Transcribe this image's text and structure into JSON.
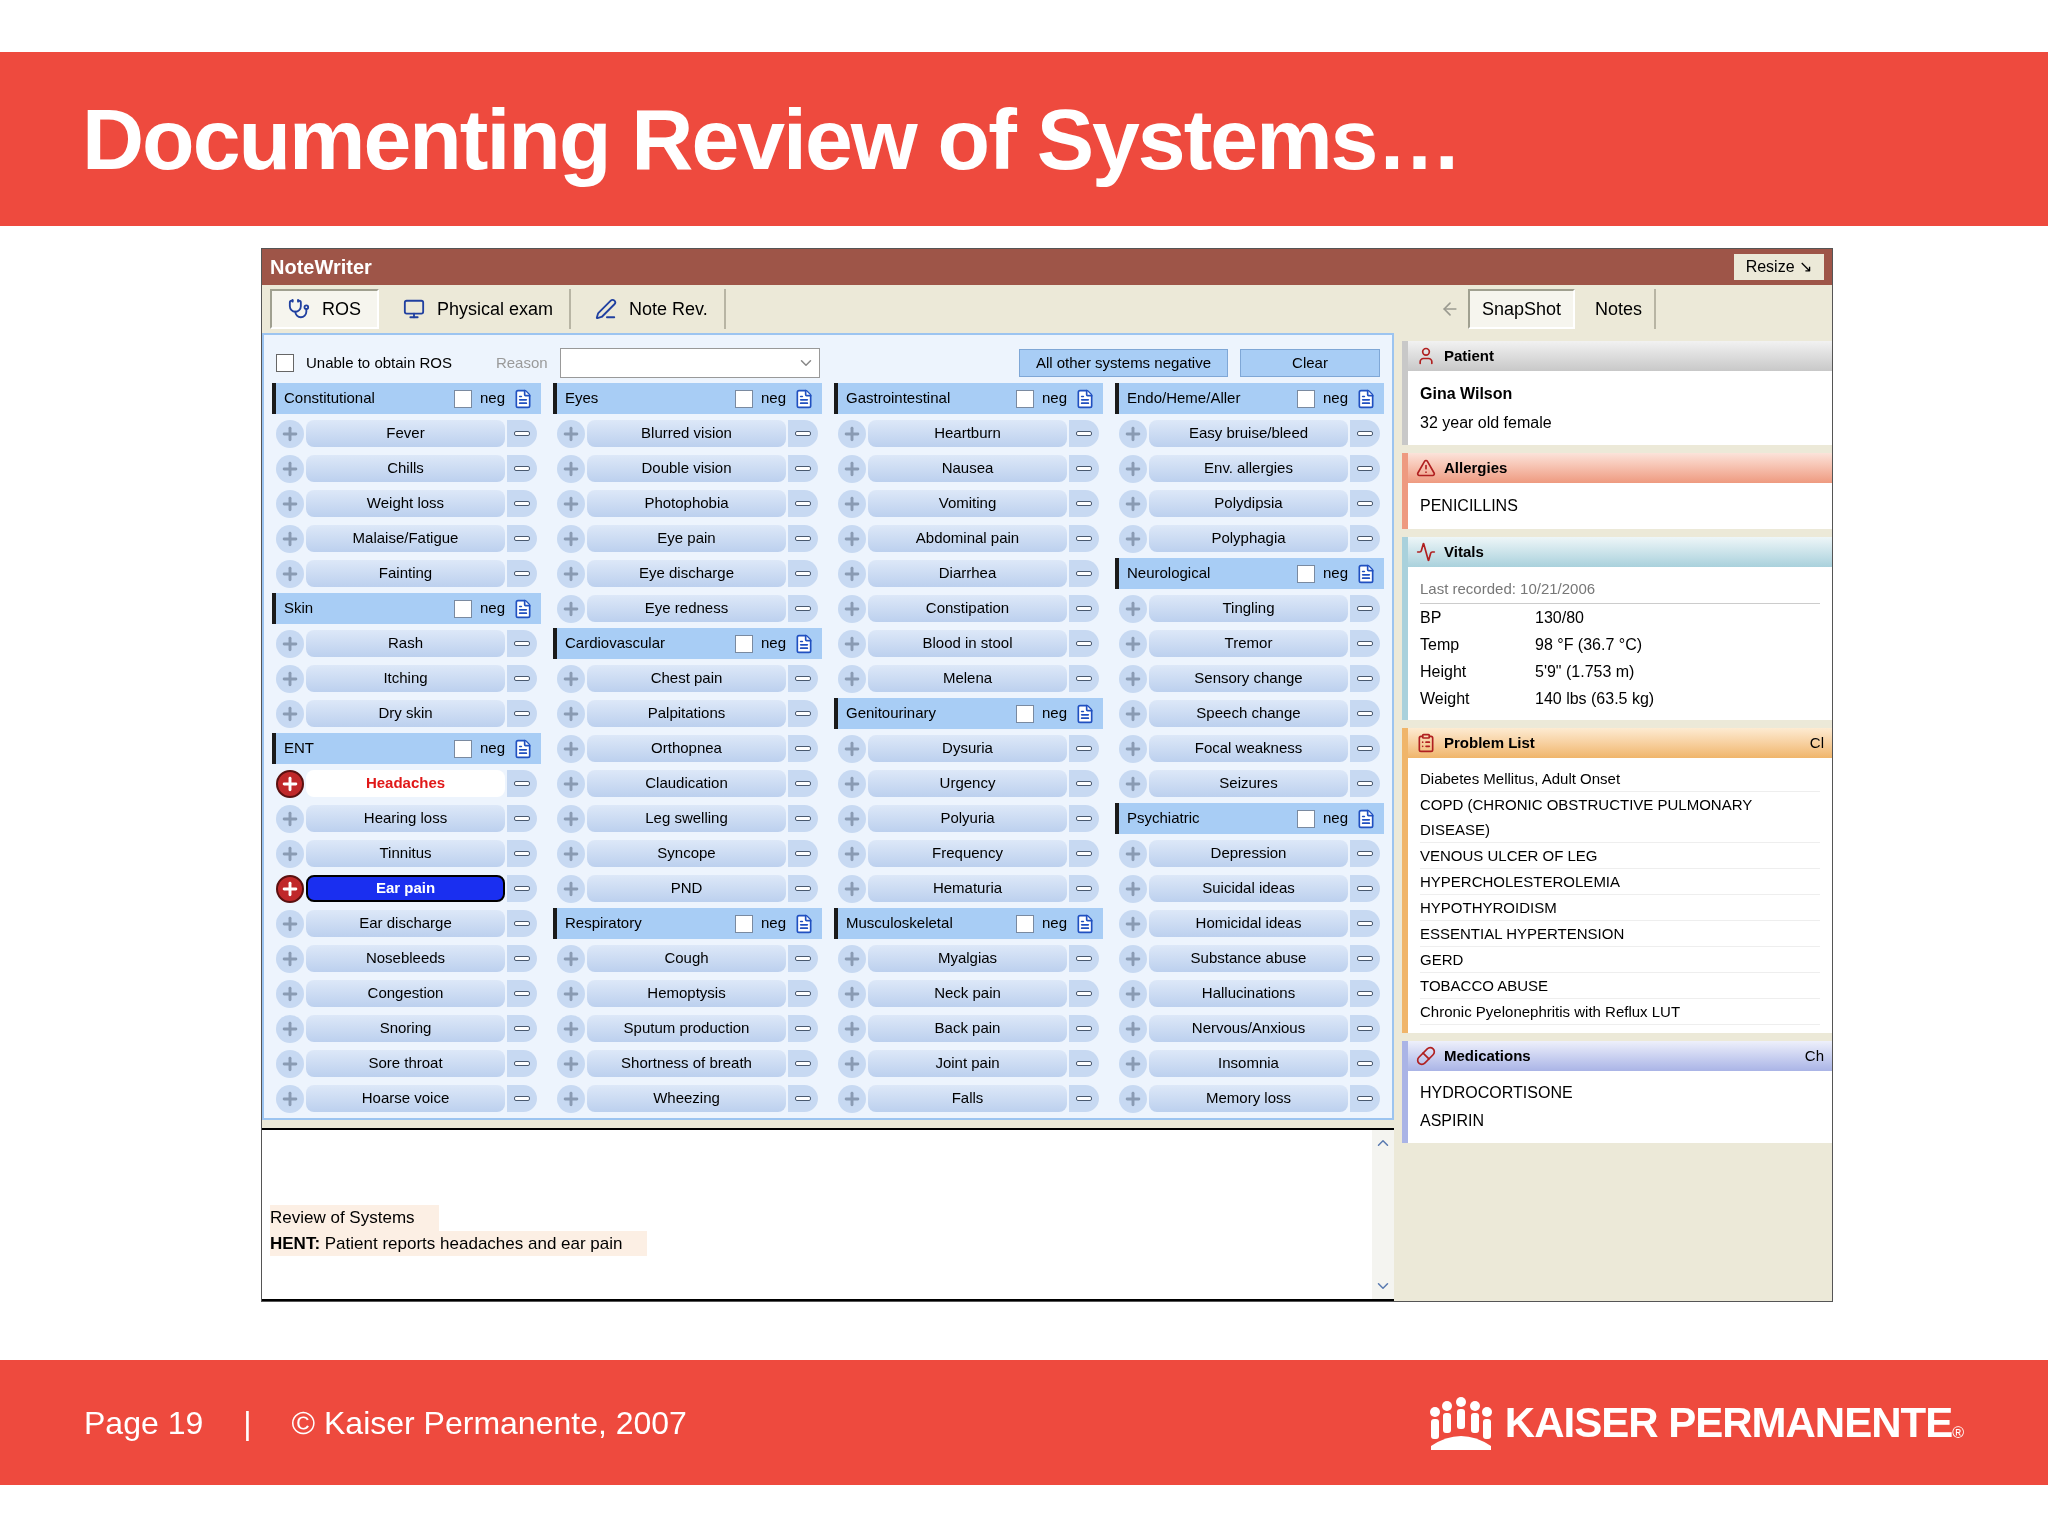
{
  "slide_title": "Documenting Review of Systems…",
  "window": {
    "title": "NoteWriter",
    "resize_button": "Resize ↘"
  },
  "toolbar": {
    "tabs": [
      {
        "label": "ROS",
        "selected": true
      },
      {
        "label": "Physical exam",
        "selected": false
      },
      {
        "label": "Note Rev.",
        "selected": false
      }
    ],
    "side_tabs": [
      {
        "label": "SnapShot",
        "selected": true
      },
      {
        "label": "Notes",
        "selected": false
      }
    ]
  },
  "ros_controls": {
    "unable": {
      "label": "Unable to obtain ROS",
      "checked": false
    },
    "reason_label": "Reason",
    "all_negative_button": "All other systems negative",
    "clear_button": "Clear"
  },
  "columns": [
    [
      {
        "title": "Constitutional",
        "neg_label": "neg",
        "neg": false,
        "items": [
          {
            "label": "Fever",
            "positive": false,
            "selected": false
          },
          {
            "label": "Chills",
            "positive": false,
            "selected": false
          },
          {
            "label": "Weight loss",
            "positive": false,
            "selected": false
          },
          {
            "label": "Malaise/Fatigue",
            "positive": false,
            "selected": false
          },
          {
            "label": "Fainting",
            "positive": false,
            "selected": false
          }
        ]
      },
      {
        "title": "Skin",
        "neg_label": "neg",
        "neg": false,
        "items": [
          {
            "label": "Rash",
            "positive": false,
            "selected": false
          },
          {
            "label": "Itching",
            "positive": false,
            "selected": false
          },
          {
            "label": "Dry skin",
            "positive": false,
            "selected": false
          }
        ]
      },
      {
        "title": "ENT",
        "neg_label": "neg",
        "neg": false,
        "items": [
          {
            "label": "Headaches",
            "positive": true,
            "selected": false
          },
          {
            "label": "Hearing loss",
            "positive": false,
            "selected": false
          },
          {
            "label": "Tinnitus",
            "positive": false,
            "selected": false
          },
          {
            "label": "Ear pain",
            "positive": true,
            "selected": true
          },
          {
            "label": "Ear discharge",
            "positive": false,
            "selected": false
          },
          {
            "label": "Nosebleeds",
            "positive": false,
            "selected": false
          },
          {
            "label": "Congestion",
            "positive": false,
            "selected": false
          },
          {
            "label": "Snoring",
            "positive": false,
            "selected": false
          },
          {
            "label": "Sore throat",
            "positive": false,
            "selected": false
          },
          {
            "label": "Hoarse voice",
            "positive": false,
            "selected": false
          }
        ]
      }
    ],
    [
      {
        "title": "Eyes",
        "neg_label": "neg",
        "neg": false,
        "items": [
          {
            "label": "Blurred vision",
            "positive": false,
            "selected": false
          },
          {
            "label": "Double vision",
            "positive": false,
            "selected": false
          },
          {
            "label": "Photophobia",
            "positive": false,
            "selected": false
          },
          {
            "label": "Eye pain",
            "positive": false,
            "selected": false
          },
          {
            "label": "Eye discharge",
            "positive": false,
            "selected": false
          },
          {
            "label": "Eye redness",
            "positive": false,
            "selected": false
          }
        ]
      },
      {
        "title": "Cardiovascular",
        "neg_label": "neg",
        "neg": false,
        "items": [
          {
            "label": "Chest pain",
            "positive": false,
            "selected": false
          },
          {
            "label": "Palpitations",
            "positive": false,
            "selected": false
          },
          {
            "label": "Orthopnea",
            "positive": false,
            "selected": false
          },
          {
            "label": "Claudication",
            "positive": false,
            "selected": false
          },
          {
            "label": "Leg swelling",
            "positive": false,
            "selected": false
          },
          {
            "label": "Syncope",
            "positive": false,
            "selected": false
          },
          {
            "label": "PND",
            "positive": false,
            "selected": false
          }
        ]
      },
      {
        "title": "Respiratory",
        "neg_label": "neg",
        "neg": false,
        "items": [
          {
            "label": "Cough",
            "positive": false,
            "selected": false
          },
          {
            "label": "Hemoptysis",
            "positive": false,
            "selected": false
          },
          {
            "label": "Sputum production",
            "positive": false,
            "selected": false
          },
          {
            "label": "Shortness of breath",
            "positive": false,
            "selected": false
          },
          {
            "label": "Wheezing",
            "positive": false,
            "selected": false
          }
        ]
      }
    ],
    [
      {
        "title": "Gastrointestinal",
        "neg_label": "neg",
        "neg": false,
        "items": [
          {
            "label": "Heartburn",
            "positive": false,
            "selected": false
          },
          {
            "label": "Nausea",
            "positive": false,
            "selected": false
          },
          {
            "label": "Vomiting",
            "positive": false,
            "selected": false
          },
          {
            "label": "Abdominal pain",
            "positive": false,
            "selected": false
          },
          {
            "label": "Diarrhea",
            "positive": false,
            "selected": false
          },
          {
            "label": "Constipation",
            "positive": false,
            "selected": false
          },
          {
            "label": "Blood in stool",
            "positive": false,
            "selected": false
          },
          {
            "label": "Melena",
            "positive": false,
            "selected": false
          }
        ]
      },
      {
        "title": "Genitourinary",
        "neg_label": "neg",
        "neg": false,
        "items": [
          {
            "label": "Dysuria",
            "positive": false,
            "selected": false
          },
          {
            "label": "Urgency",
            "positive": false,
            "selected": false
          },
          {
            "label": "Polyuria",
            "positive": false,
            "selected": false
          },
          {
            "label": "Frequency",
            "positive": false,
            "selected": false
          },
          {
            "label": "Hematuria",
            "positive": false,
            "selected": false
          }
        ]
      },
      {
        "title": "Musculoskeletal",
        "neg_label": "neg",
        "neg": false,
        "items": [
          {
            "label": "Myalgias",
            "positive": false,
            "selected": false
          },
          {
            "label": "Neck pain",
            "positive": false,
            "selected": false
          },
          {
            "label": "Back pain",
            "positive": false,
            "selected": false
          },
          {
            "label": "Joint pain",
            "positive": false,
            "selected": false
          },
          {
            "label": "Falls",
            "positive": false,
            "selected": false
          }
        ]
      }
    ],
    [
      {
        "title": "Endo/Heme/Aller",
        "neg_label": "neg",
        "neg": false,
        "items": [
          {
            "label": "Easy bruise/bleed",
            "positive": false,
            "selected": false
          },
          {
            "label": "Env. allergies",
            "positive": false,
            "selected": false
          },
          {
            "label": "Polydipsia",
            "positive": false,
            "selected": false
          },
          {
            "label": "Polyphagia",
            "positive": false,
            "selected": false
          }
        ]
      },
      {
        "title": "Neurological",
        "neg_label": "neg",
        "neg": false,
        "items": [
          {
            "label": "Tingling",
            "positive": false,
            "selected": false
          },
          {
            "label": "Tremor",
            "positive": false,
            "selected": false
          },
          {
            "label": "Sensory change",
            "positive": false,
            "selected": false
          },
          {
            "label": "Speech change",
            "positive": false,
            "selected": false
          },
          {
            "label": "Focal weakness",
            "positive": false,
            "selected": false
          },
          {
            "label": "Seizures",
            "positive": false,
            "selected": false
          }
        ]
      },
      {
        "title": "Psychiatric",
        "neg_label": "neg",
        "neg": false,
        "items": [
          {
            "label": "Depression",
            "positive": false,
            "selected": false
          },
          {
            "label": "Suicidal ideas",
            "positive": false,
            "selected": false
          },
          {
            "label": "Homicidal ideas",
            "positive": false,
            "selected": false
          },
          {
            "label": "Substance abuse",
            "positive": false,
            "selected": false
          },
          {
            "label": "Hallucinations",
            "positive": false,
            "selected": false
          },
          {
            "label": "Nervous/Anxious",
            "positive": false,
            "selected": false
          },
          {
            "label": "Insomnia",
            "positive": false,
            "selected": false
          },
          {
            "label": "Memory loss",
            "positive": false,
            "selected": false
          }
        ]
      }
    ]
  ],
  "note": {
    "lines": [
      "Review of Systems",
      "**HENT:** Patient reports headaches and ear pain"
    ]
  },
  "snapshot": {
    "patient": {
      "title": "Patient",
      "name": "Gina Wilson",
      "description": "32 year old female"
    },
    "allergies": {
      "title": "Allergies",
      "items": [
        "PENICILLINS"
      ]
    },
    "vitals": {
      "title": "Vitals",
      "recorded": "Last recorded: 10/21/2006",
      "rows": [
        {
          "label": "BP",
          "value": "130/80"
        },
        {
          "label": "Temp",
          "value": "98 °F (36.7 °C)"
        },
        {
          "label": "Height",
          "value": "5'9\" (1.753 m)"
        },
        {
          "label": "Weight",
          "value": "140 lbs (63.5 kg)"
        }
      ]
    },
    "problems": {
      "title": "Problem List",
      "action": "Cl",
      "items": [
        "Diabetes Mellitus, Adult Onset",
        "COPD (CHRONIC OBSTRUCTIVE PULMONARY DISEASE)",
        "VENOUS ULCER OF LEG",
        "HYPERCHOLESTEROLEMIA",
        "HYPOTHYROIDISM",
        "ESSENTIAL HYPERTENSION",
        "GERD",
        "TOBACCO ABUSE",
        "Chronic Pyelonephritis with Reflux LUT"
      ]
    },
    "medications": {
      "title": "Medications",
      "action": "Ch",
      "items": [
        "HYDROCORTISONE",
        "ASPIRIN"
      ]
    }
  },
  "footer": {
    "page": "Page 19",
    "separator": "|",
    "copyright": "© Kaiser Permanente, 2007",
    "logo_text": "KAISER PERMANENTE",
    "logo_mark": "®"
  }
}
